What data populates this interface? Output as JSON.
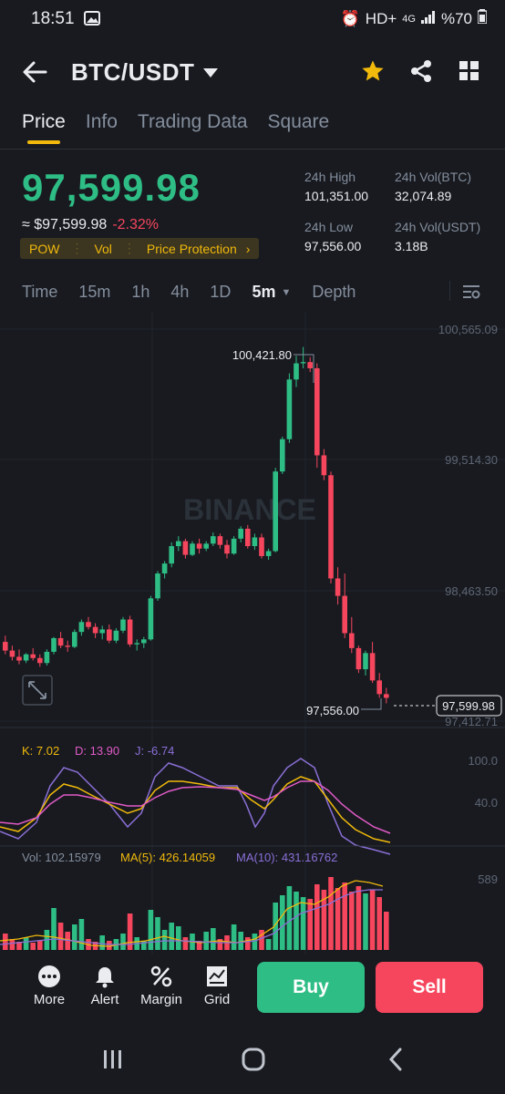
{
  "status_bar": {
    "time": "18:51",
    "network": "HD+",
    "signal": "4G",
    "battery": "%70"
  },
  "header": {
    "pair": "BTC/USDT"
  },
  "tabs": [
    {
      "label": "Price",
      "active": true
    },
    {
      "label": "Info"
    },
    {
      "label": "Trading Data"
    },
    {
      "label": "Square"
    }
  ],
  "ticker": {
    "last_price": "97,599.98",
    "approx_label": "≈ $97,599.98",
    "change": "-2.32%",
    "tags": [
      "POW",
      "Vol",
      "Price Protection"
    ],
    "high_label": "24h High",
    "high_value": "101,351.00",
    "vol_btc_label": "24h Vol(BTC)",
    "vol_btc_value": "32,074.89",
    "low_label": "24h Low",
    "low_value": "97,556.00",
    "vol_usdt_label": "24h Vol(USDT)",
    "vol_usdt_value": "3.18B"
  },
  "timeframes": [
    "Time",
    "15m",
    "1h",
    "4h",
    "1D",
    "5m",
    "Depth"
  ],
  "selected_timeframe": "5m",
  "chart": {
    "watermark": "BINANCE",
    "price_axis": [
      "100,565.09",
      "99,514.30",
      "98,463.50",
      "97,412.71"
    ],
    "high_annotation": "100,421.80",
    "low_annotation": "97,556.00",
    "current_price_tag": "97,599.98",
    "kdj": {
      "k": "K: 7.02",
      "d": "D: 13.90",
      "j": "J: -6.74",
      "axis_top": "100.0",
      "axis_mid": "40.0"
    },
    "volume": {
      "vol": "Vol: 102.15979",
      "ma5": "MA(5): 426.14059",
      "ma10": "MA(10): 431.16762",
      "axis_top": "589"
    },
    "colors": {
      "up": "#2ebd85",
      "down": "#f6465d",
      "k": "#f0b90b",
      "d": "#e05ac6",
      "j": "#8b6fd6"
    }
  },
  "chart_data": {
    "type": "candlestick",
    "ylim": [
      97412.71,
      100565.09
    ],
    "candles": [
      [
        98050,
        98100,
        97950,
        97980
      ],
      [
        97980,
        98020,
        97900,
        97930
      ],
      [
        97930,
        97990,
        97870,
        97900
      ],
      [
        97900,
        97960,
        97880,
        97950
      ],
      [
        97950,
        98000,
        97900,
        97920
      ],
      [
        97920,
        97950,
        97850,
        97880
      ],
      [
        97880,
        97990,
        97860,
        97970
      ],
      [
        97970,
        98090,
        97950,
        98080
      ],
      [
        98080,
        98130,
        98000,
        98020
      ],
      [
        98020,
        98060,
        97970,
        98010
      ],
      [
        98010,
        98150,
        98000,
        98130
      ],
      [
        98130,
        98230,
        98100,
        98210
      ],
      [
        98210,
        98250,
        98150,
        98170
      ],
      [
        98170,
        98200,
        98080,
        98120
      ],
      [
        98120,
        98180,
        98070,
        98150
      ],
      [
        98150,
        98190,
        98040,
        98060
      ],
      [
        98060,
        98160,
        98040,
        98140
      ],
      [
        98140,
        98250,
        98120,
        98230
      ],
      [
        98230,
        98260,
        98010,
        98030
      ],
      [
        98030,
        98070,
        97980,
        98040
      ],
      [
        98040,
        98090,
        98000,
        98070
      ],
      [
        98070,
        98420,
        98060,
        98400
      ],
      [
        98400,
        98620,
        98380,
        98600
      ],
      [
        98600,
        98700,
        98560,
        98680
      ],
      [
        98680,
        98850,
        98650,
        98820
      ],
      [
        98820,
        98900,
        98780,
        98860
      ],
      [
        98860,
        98880,
        98720,
        98750
      ],
      [
        98750,
        98860,
        98740,
        98840
      ],
      [
        98840,
        98880,
        98760,
        98800
      ],
      [
        98800,
        98860,
        98780,
        98840
      ],
      [
        98840,
        98930,
        98820,
        98900
      ],
      [
        98900,
        98920,
        98800,
        98830
      ],
      [
        98830,
        98870,
        98720,
        98760
      ],
      [
        98760,
        98900,
        98750,
        98880
      ],
      [
        98880,
        98980,
        98850,
        98960
      ],
      [
        98960,
        98990,
        98800,
        98820
      ],
      [
        98820,
        98920,
        98790,
        98890
      ],
      [
        98890,
        98920,
        98720,
        98740
      ],
      [
        98740,
        98800,
        98710,
        98780
      ],
      [
        98780,
        99450,
        98770,
        99420
      ],
      [
        99420,
        99700,
        99400,
        99680
      ],
      [
        99680,
        100210,
        99650,
        100160
      ],
      [
        100160,
        100350,
        100100,
        100290
      ],
      [
        100290,
        100421.8,
        100250,
        100300
      ],
      [
        100300,
        100340,
        100220,
        100250
      ],
      [
        100250,
        100290,
        99450,
        99550
      ],
      [
        99550,
        99600,
        99350,
        99390
      ],
      [
        99390,
        99420,
        98520,
        98560
      ],
      [
        98560,
        98650,
        98350,
        98420
      ],
      [
        98420,
        98600,
        98080,
        98120
      ],
      [
        98120,
        98250,
        97960,
        98000
      ],
      [
        98000,
        98020,
        97800,
        97830
      ],
      [
        97830,
        97980,
        97780,
        97960
      ],
      [
        97960,
        98050,
        97720,
        97740
      ],
      [
        97740,
        97800,
        97600,
        97630
      ],
      [
        97630,
        97680,
        97556,
        97600
      ]
    ],
    "volume_axis_top": 589,
    "kdj_axis": [
      100.0,
      40.0
    ]
  }
}
